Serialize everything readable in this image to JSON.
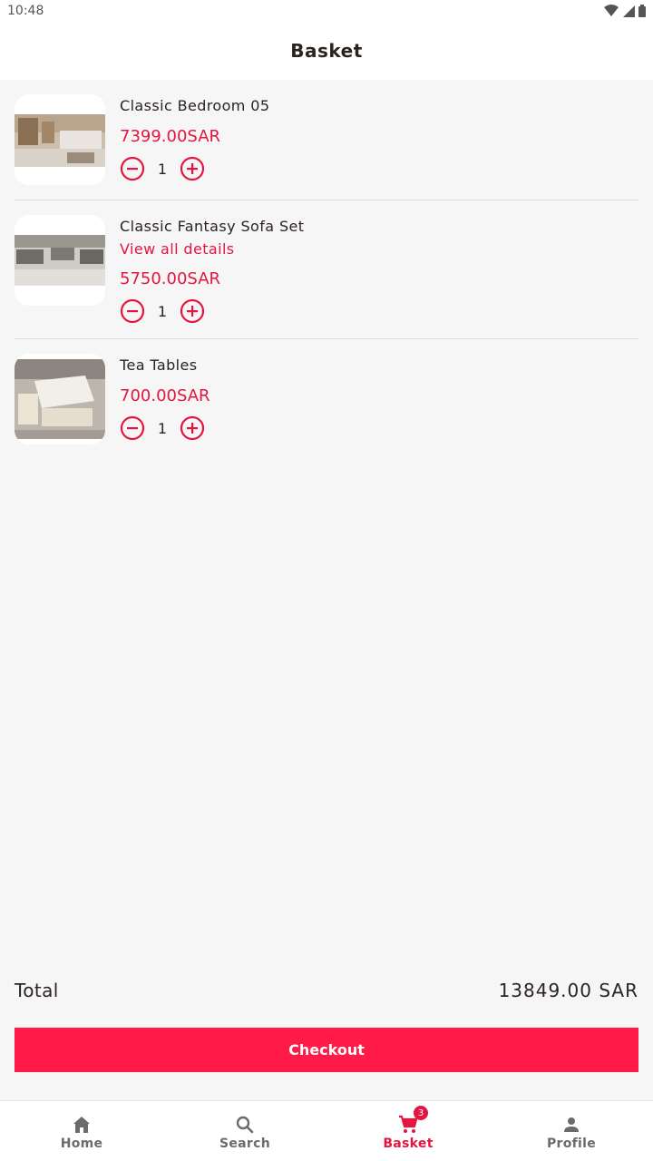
{
  "status_bar": {
    "time": "10:48"
  },
  "header": {
    "title": "Basket"
  },
  "items": [
    {
      "name": "Classic Bedroom 05",
      "link": "",
      "price": "7399.00SAR",
      "quantity": "1",
      "image": "bedroom-photo"
    },
    {
      "name": "Classic Fantasy Sofa Set",
      "link": "View all details",
      "price": "5750.00SAR",
      "quantity": "1",
      "image": "sofa-photo"
    },
    {
      "name": "Tea Tables",
      "link": "",
      "price": "700.00SAR",
      "quantity": "1",
      "image": "tea-table-photo"
    }
  ],
  "summary": {
    "total_label": "Total",
    "total_value": "13849.00 SAR"
  },
  "checkout": {
    "label": "Checkout"
  },
  "nav": {
    "home": "Home",
    "search": "Search",
    "basket": "Basket",
    "basket_badge": "3",
    "profile": "Profile"
  },
  "colors": {
    "accent": "#e4163f",
    "button": "#ff1a47",
    "background": "#f6f6f6"
  }
}
